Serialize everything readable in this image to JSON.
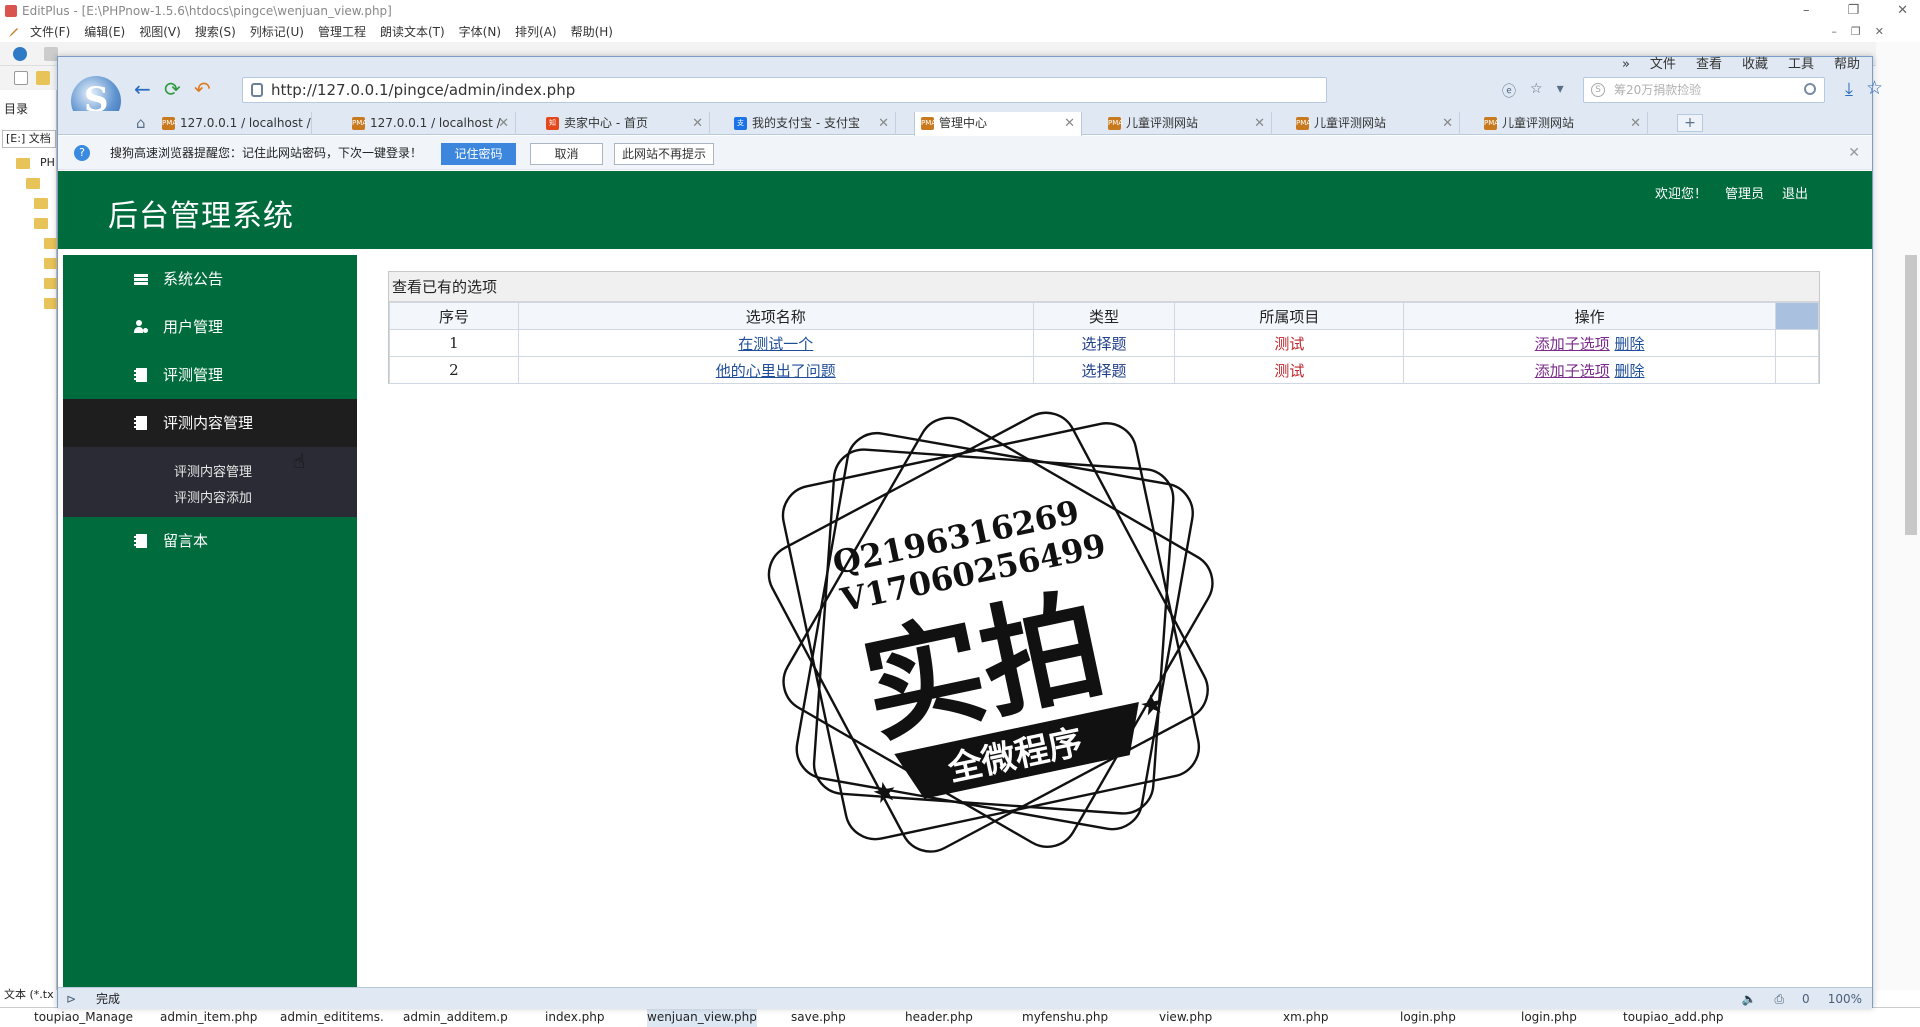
{
  "editor": {
    "title": "EditPlus - [E:\\PHPnow-1.5.6\\htdocs\\pingce\\wenjuan_view.php]",
    "window_buttons": [
      "–",
      "❐",
      "✕"
    ],
    "mdi_buttons": [
      "–",
      "❐",
      "✕"
    ],
    "menu": [
      "文件(F)",
      "编辑(E)",
      "视图(V)",
      "搜索(S)",
      "列标记(U)",
      "管理工程",
      "朗读文本(T)",
      "字体(N)",
      "排列(A)",
      "帮助(H)"
    ],
    "left_panel": {
      "tab": "目录",
      "path": "[E:] 文档",
      "folder_label": "PH",
      "bottom_text": "文本 (*.tx"
    },
    "file_tabs": [
      "toupiao_Manage",
      "admin_item.php",
      "admin_edititems.",
      "admin_additem.p",
      "index.php",
      "wenjuan_view.php",
      "save.php",
      "header.php",
      "myfenshu.php",
      "view.php",
      "xm.php",
      "login.php",
      "login.php",
      "toupiao_add.php"
    ]
  },
  "browser": {
    "url": "http://127.0.0.1/pingce/admin/index.php",
    "search_placeholder": "筹20万捐款捡验",
    "top_menu": [
      "»",
      "文件",
      "查看",
      "收藏",
      "工具",
      "帮助"
    ],
    "tabs": [
      {
        "label": "127.0.0.1 / localhost /",
        "fav": "PMA",
        "fav_color": "#c97a1e"
      },
      {
        "label": "127.0.0.1 / localhost /",
        "fav": "PMA",
        "fav_color": "#c97a1e"
      },
      {
        "label": "卖家中心 - 首页",
        "fav": "知",
        "fav_color": "#e4481b"
      },
      {
        "label": "我的支付宝 - 支付宝",
        "fav": "支",
        "fav_color": "#1b73e8"
      },
      {
        "label": "管理中心",
        "fav": "PMA",
        "fav_color": "#c97a1e"
      },
      {
        "label": "儿童评测网站",
        "fav": "PMA",
        "fav_color": "#c97a1e"
      },
      {
        "label": "儿童评测网站",
        "fav": "PMA",
        "fav_color": "#c97a1e"
      },
      {
        "label": "儿童评测网站",
        "fav": "PMA",
        "fav_color": "#c97a1e"
      }
    ],
    "tab_add": "+",
    "notify": {
      "message": "搜狗高速浏览器提醒您：记住此网站密码，下次一键登录！",
      "remember": "记住密码",
      "cancel": "取消",
      "never": "此网站不再提示"
    },
    "status": {
      "left": "完成",
      "zoom": "100%",
      "count": "0"
    }
  },
  "site": {
    "title": "后台管理系统",
    "welcome": "欢迎您！",
    "user": "管理员",
    "logout": "退出",
    "colors": {
      "header": "#006b3c",
      "active_menu": "#1e1e1e",
      "submenu": "#2b2b35"
    },
    "sidebar": [
      {
        "label": "系统公告",
        "icon": "stack-icon"
      },
      {
        "label": "用户管理",
        "icon": "user-gear-icon"
      },
      {
        "label": "评测管理",
        "icon": "notebook-icon"
      },
      {
        "label": "评测内容管理",
        "icon": "notebook-icon"
      },
      {
        "label": "留言本",
        "icon": "notebook-icon"
      }
    ],
    "submenu": [
      "评测内容管理",
      "评测内容添加"
    ]
  },
  "panel": {
    "title": "查看已有的选项",
    "headers": [
      "序号",
      "选项名称",
      "类型",
      "所属项目",
      "操作"
    ],
    "rows": [
      {
        "id": "1",
        "name": "在测试一个",
        "type": "选择题",
        "project": "测试",
        "action1": "添加子选项",
        "action2": "删除"
      },
      {
        "id": "2",
        "name": "他的心里出了问题",
        "type": "选择题",
        "project": "测试",
        "action1": "添加子选项",
        "action2": "删除"
      }
    ]
  },
  "watermark": {
    "line1": "Q2196316269",
    "line2": "V17060256499",
    "main": "实拍",
    "banner": "全微程序"
  }
}
